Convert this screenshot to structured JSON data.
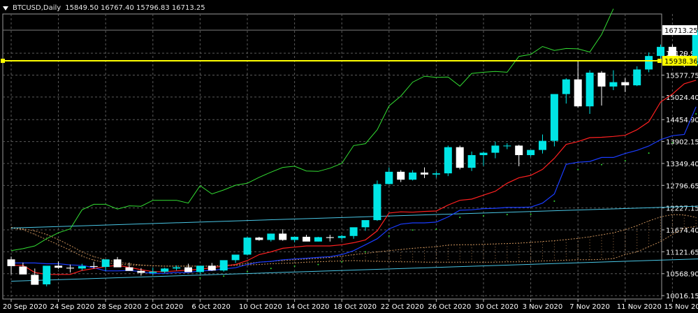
{
  "header": {
    "symbol": "BTCUSD,Daily",
    "ohlc": "15849.50 16767.40 15796.83 16713.25"
  },
  "colors": {
    "background": "#000000",
    "grid": "#5a5a5a",
    "bull": "#00e5e5",
    "bear": "#ffffff",
    "tenkan": "#ff2020",
    "kijun": "#1a3cff",
    "chikou": "#33dd33",
    "channel": "#49c6e5",
    "level": "#ffff00",
    "cloud": "#c8905a"
  },
  "price_axis": {
    "ticks": [
      "16129.90",
      "15577.75",
      "15024.40",
      "14454.90",
      "13902.15",
      "13349.40",
      "12796.65",
      "12227.15",
      "11674.40",
      "11121.65",
      "10568.90",
      "10016.15"
    ],
    "current_label": "16713.25",
    "level_label": "15938.36"
  },
  "time_axis": {
    "ticks": [
      "20 Sep 2020",
      "24 Sep 2020",
      "28 Sep 2020",
      "2 Oct 2020",
      "6 Oct 2020",
      "10 Oct 2020",
      "14 Oct 2020",
      "18 Oct 2020",
      "22 Oct 2020",
      "26 Oct 2020",
      "30 Oct 2020",
      "3 Nov 2020",
      "7 Nov 2020",
      "11 Nov 2020",
      "15 Nov 2020"
    ]
  },
  "chart_data": {
    "type": "candlestick",
    "horizontal_level": 15938.36,
    "candles": [
      [
        10930,
        11000,
        10550,
        10760
      ],
      [
        10750,
        10850,
        10600,
        10550
      ],
      [
        10540,
        10700,
        10330,
        10290
      ],
      [
        10300,
        10700,
        10250,
        10770
      ],
      [
        10770,
        10880,
        10690,
        10720
      ],
      [
        10720,
        10800,
        10600,
        10700
      ],
      [
        10700,
        10820,
        10650,
        10760
      ],
      [
        10760,
        10870,
        10700,
        10740
      ],
      [
        10740,
        10820,
        10640,
        10930
      ],
      [
        10930,
        10990,
        10830,
        10730
      ],
      [
        10730,
        10850,
        10650,
        10640
      ],
      [
        10640,
        10710,
        10520,
        10590
      ],
      [
        10590,
        10720,
        10540,
        10620
      ],
      [
        10620,
        10720,
        10580,
        10700
      ],
      [
        10700,
        10780,
        10650,
        10730
      ],
      [
        10730,
        10820,
        10620,
        10610
      ],
      [
        10610,
        10710,
        10560,
        10770
      ],
      [
        10770,
        10840,
        10640,
        10650
      ],
      [
        10650,
        10810,
        10620,
        10910
      ],
      [
        10910,
        11020,
        10840,
        11050
      ],
      [
        11050,
        11500,
        11030,
        11480
      ],
      [
        11480,
        11500,
        11400,
        11420
      ],
      [
        11420,
        11580,
        11380,
        11580
      ],
      [
        11580,
        11690,
        11400,
        11420
      ],
      [
        11420,
        11500,
        11360,
        11500
      ],
      [
        11500,
        11550,
        11400,
        11380
      ],
      [
        11380,
        11500,
        11380,
        11490
      ],
      [
        11490,
        11550,
        11380,
        11470
      ],
      [
        11470,
        11550,
        11420,
        11520
      ],
      [
        11520,
        11700,
        11450,
        11740
      ],
      [
        11740,
        11870,
        11650,
        11920
      ],
      [
        11920,
        12920,
        11900,
        12830
      ],
      [
        12830,
        13250,
        12820,
        13140
      ],
      [
        13140,
        13180,
        12880,
        12940
      ],
      [
        12940,
        13180,
        12920,
        13120
      ],
      [
        13120,
        13250,
        12980,
        13070
      ],
      [
        13070,
        13150,
        12990,
        13100
      ],
      [
        13100,
        13800,
        13030,
        13760
      ],
      [
        13760,
        13800,
        13200,
        13240
      ],
      [
        13240,
        13650,
        13160,
        13560
      ],
      [
        13560,
        13650,
        13290,
        13620
      ],
      [
        13620,
        13900,
        13480,
        13800
      ],
      [
        13800,
        13860,
        13710,
        13800
      ],
      [
        13800,
        13820,
        13280,
        13560
      ],
      [
        13560,
        13680,
        13520,
        13690
      ],
      [
        13690,
        14080,
        13600,
        13920
      ],
      [
        13920,
        15000,
        13780,
        15100
      ],
      [
        15100,
        15500,
        14860,
        15470
      ],
      [
        15470,
        15930,
        14760,
        14790
      ],
      [
        14790,
        15700,
        14600,
        15640
      ],
      [
        15640,
        15680,
        14810,
        15290
      ],
      [
        15290,
        15700,
        15200,
        15400
      ],
      [
        15400,
        15500,
        15150,
        15320
      ],
      [
        15320,
        15800,
        15300,
        15720
      ],
      [
        15720,
        16150,
        15650,
        16060
      ],
      [
        16060,
        16350,
        15960,
        16290
      ],
      [
        16290,
        16350,
        15980,
        15970
      ],
      [
        15970,
        16150,
        15780,
        15850
      ],
      [
        15849.5,
        16767.4,
        15796.83,
        16713.25
      ]
    ],
    "tenkan": [
      10780,
      10780,
      10600,
      10550,
      10550,
      10550,
      10650,
      10700,
      10750,
      10780,
      10730,
      10670,
      10620,
      10620,
      10640,
      10660,
      10680,
      10720,
      10760,
      10800,
      10900,
      11050,
      11120,
      11210,
      11240,
      11270,
      11270,
      11270,
      11300,
      11350,
      11420,
      11650,
      12100,
      12130,
      12120,
      12140,
      12150,
      12300,
      12420,
      12450,
      12550,
      12650,
      12850,
      12990,
      13050,
      13200,
      13480,
      13830,
      13900,
      14000,
      14010,
      14030,
      14060,
      14200,
      14400,
      14900,
      15100,
      15360,
      15450
    ],
    "kijun": [
      10840,
      10840,
      10840,
      10820,
      10820,
      10790,
      10780,
      10720,
      10640,
      10640,
      10650,
      10620,
      10570,
      10580,
      10600,
      10600,
      10640,
      10650,
      10690,
      10720,
      10800,
      10860,
      10880,
      10920,
      10940,
      10960,
      10980,
      11000,
      11050,
      11150,
      11300,
      11450,
      11700,
      11820,
      11850,
      11850,
      11870,
      12000,
      12170,
      12180,
      12210,
      12220,
      12240,
      12240,
      12250,
      12350,
      12580,
      13330,
      13380,
      13400,
      13500,
      13500,
      13600,
      13680,
      13790,
      13950,
      14050,
      14080,
      14780
    ],
    "chikou": [
      11150,
      11200,
      11270,
      11450,
      11600,
      11700,
      12180,
      12320,
      12320,
      12200,
      12280,
      12270,
      12420,
      12420,
      12420,
      12350,
      12790,
      12580,
      12680,
      12800,
      12850,
      13000,
      13130,
      13250,
      13280,
      13160,
      13150,
      13230,
      13350,
      13800,
      13850,
      14200,
      14800,
      15050,
      15400,
      15550,
      15520,
      15530,
      15300,
      15620,
      15650,
      15670,
      15650,
      16050,
      16100,
      16300,
      16200,
      16250,
      16240,
      16160,
      16600,
      17250
    ],
    "channel_upper": [
      [
        0,
        11720
      ],
      [
        59,
        12280
      ]
    ],
    "channel_lower": [
      [
        0,
        10380
      ],
      [
        59,
        10950
      ]
    ],
    "span_a": [
      11740,
      11700,
      11650,
      11560,
      11430,
      11280,
      11120,
      11000,
      10920,
      10860,
      10820,
      10790,
      10770,
      10760,
      10760,
      10760,
      10760,
      10760,
      10780,
      10800,
      10830,
      10860,
      10880,
      10900,
      10920,
      10940,
      10960,
      10980,
      11010,
      11050,
      11080,
      11120,
      11150,
      11180,
      11210,
      11230,
      11250,
      11290,
      11300,
      11300,
      11310,
      11320,
      11330,
      11340,
      11360,
      11380,
      11400,
      11430,
      11460,
      11500,
      11550,
      11600,
      11680,
      11780,
      11900,
      12000,
      12060,
      12050,
      11990
    ],
    "span_b": [
      11720,
      11680,
      11560,
      11430,
      11300,
      11160,
      11010,
      10910,
      10850,
      10810,
      10790,
      10780,
      10770,
      10760,
      10760,
      10760,
      10760,
      10760,
      10770,
      10780,
      10790,
      10800,
      10820,
      10830,
      10840,
      10860,
      10870,
      10880,
      10890,
      10900,
      10890,
      10880,
      10880,
      10870,
      10870,
      10860,
      10860,
      10860,
      10860,
      10860,
      10860,
      10860,
      10870,
      10870,
      10880,
      10890,
      10900,
      10910,
      10920,
      10920,
      10930,
      10950,
      11050,
      11120,
      11250,
      11380,
      11560,
      11720,
      11760
    ]
  }
}
